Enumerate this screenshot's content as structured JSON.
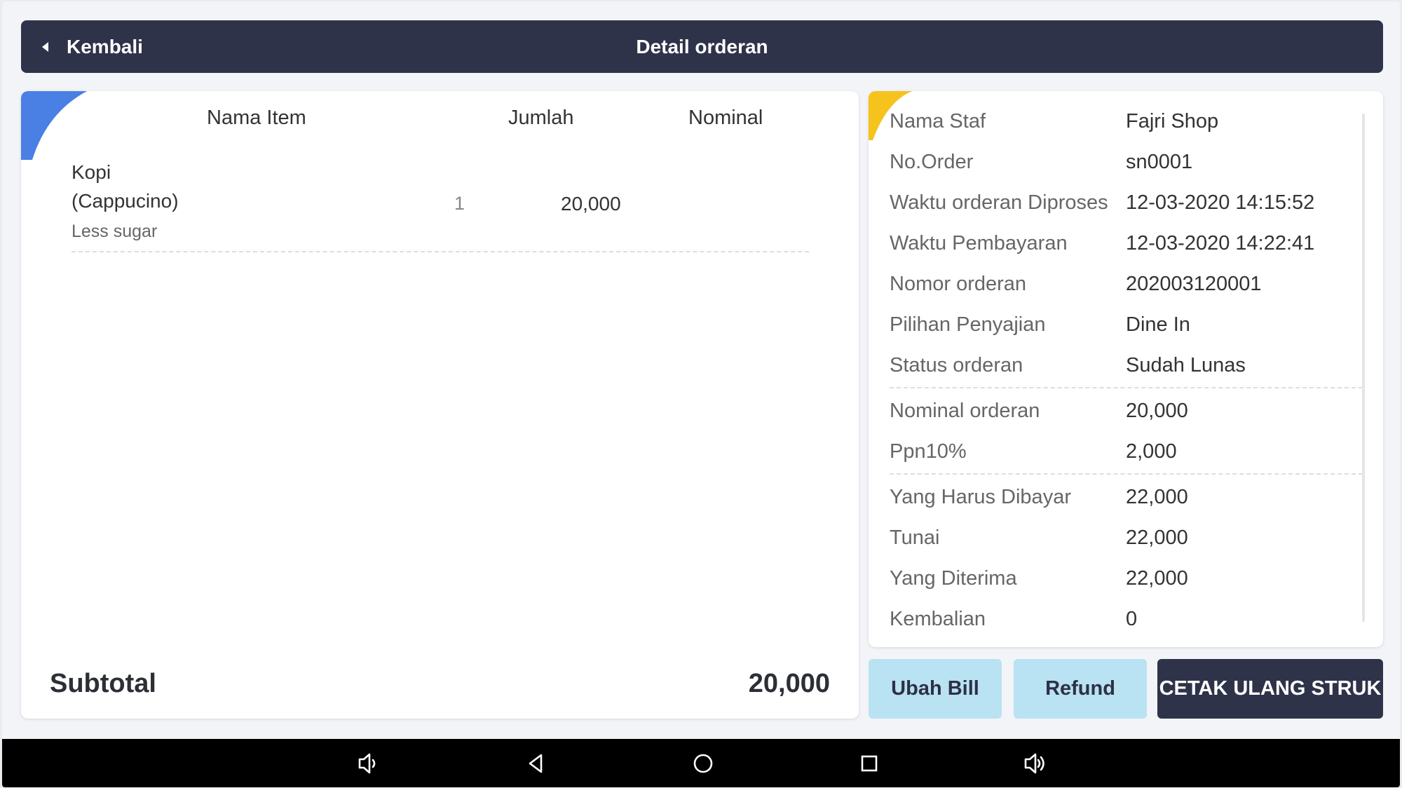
{
  "header": {
    "back_label": "Kembali",
    "title": "Detail orderan"
  },
  "items_table": {
    "columns": [
      "Nama Item",
      "Jumlah",
      "Nominal"
    ],
    "rows": [
      {
        "name": "Kopi\n(Cappucino)",
        "note": "Less sugar",
        "qty": "1",
        "nominal": "20,000"
      }
    ]
  },
  "subtotal": {
    "label": "Subtotal",
    "value": "20,000"
  },
  "order_info": [
    {
      "key": "Nama Staf",
      "value": "Fajri Shop"
    },
    {
      "key": "No.Order",
      "value": "sn0001"
    },
    {
      "key": "Waktu orderan Diproses",
      "value": "12-03-2020 14:15:52"
    },
    {
      "key": "Waktu Pembayaran",
      "value": "12-03-2020 14:22:41"
    },
    {
      "key": "Nomor orderan",
      "value": "202003120001"
    },
    {
      "key": "Pilihan Penyajian",
      "value": "Dine In"
    },
    {
      "key": "Status orderan",
      "value": "Sudah Lunas"
    },
    {
      "key": "Nominal orderan",
      "value": "20,000"
    },
    {
      "key": "Ppn10%",
      "value": "2,000"
    },
    {
      "key": "Yang Harus Dibayar",
      "value": "22,000"
    },
    {
      "key": "Tunai",
      "value": "22,000"
    },
    {
      "key": "Yang Diterima",
      "value": "22,000"
    },
    {
      "key": "Kembalian",
      "value": "0"
    }
  ],
  "buttons": {
    "edit_bill": "Ubah Bill",
    "refund": "Refund",
    "reprint": "CETAK ULANG STRUK"
  },
  "navbar_icons": [
    "volume-down-icon",
    "back-icon",
    "home-icon",
    "recents-icon",
    "volume-up-icon"
  ],
  "colors": {
    "header_bg": "#2e3349",
    "accent_blue": "#4a7fe4",
    "accent_yellow": "#f6c21c",
    "light_button": "#b9e2f3"
  }
}
